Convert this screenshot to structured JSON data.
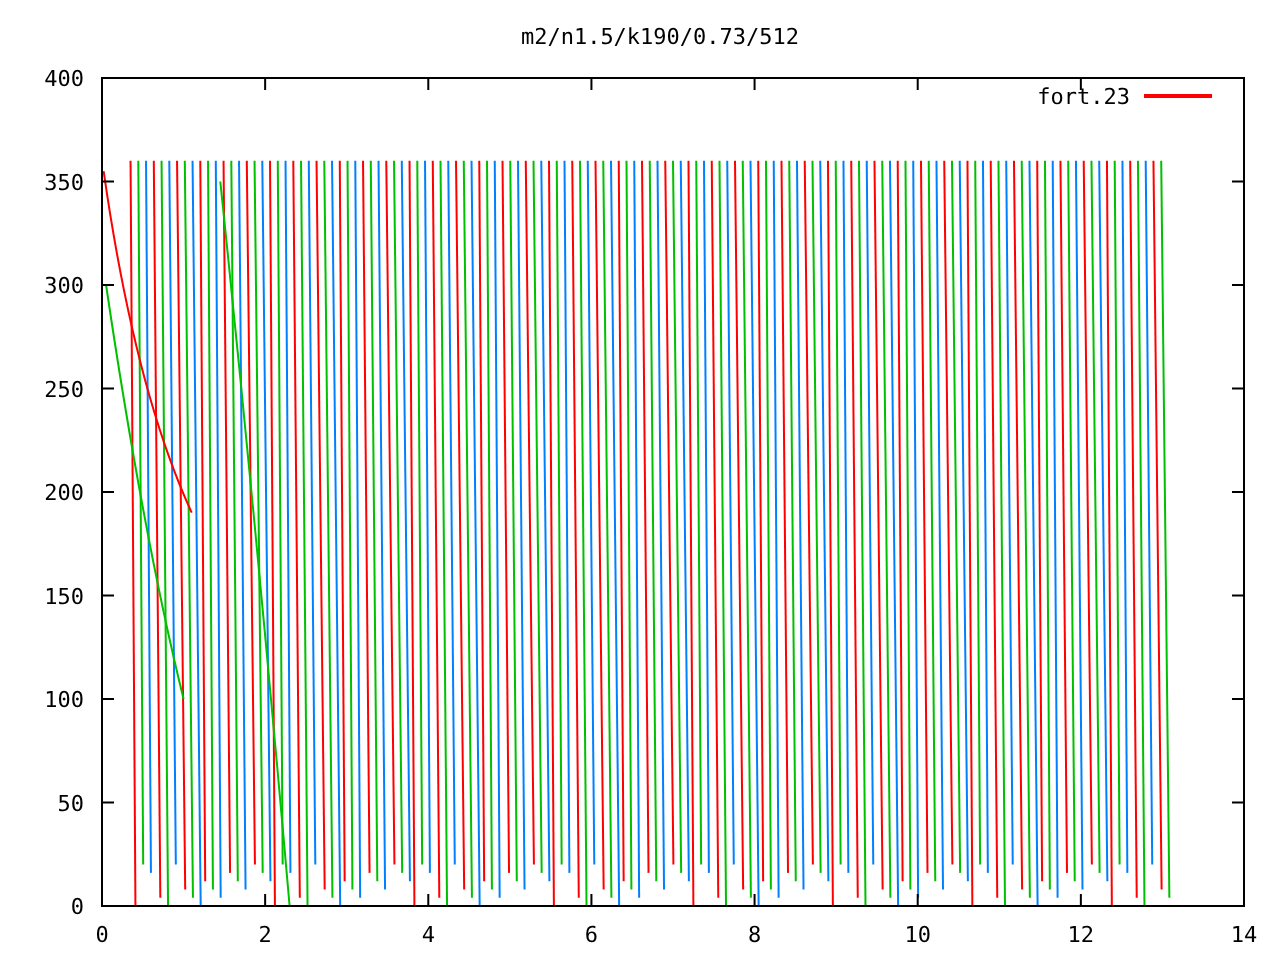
{
  "plot": {
    "title": "m2/n1.5/k190/0.73/512",
    "x_ticks": [
      "0",
      "2",
      "4",
      "6",
      "8",
      "10",
      "12",
      "14"
    ],
    "y_ticks": [
      "400",
      "350",
      "300",
      "250",
      "200",
      "150",
      "100",
      "50",
      "0"
    ],
    "legend": {
      "label": "fort.23",
      "color": "#ff0000"
    }
  }
}
